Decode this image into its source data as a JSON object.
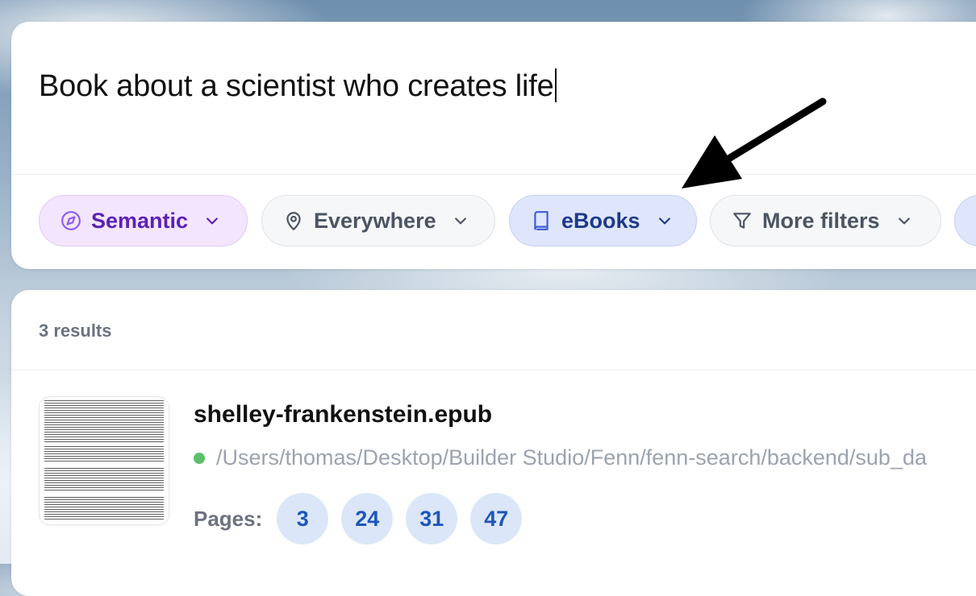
{
  "search": {
    "query": "Book about a scientist who creates life"
  },
  "filters": {
    "mode": {
      "label": "Semantic",
      "icon": "compass-icon"
    },
    "location": {
      "label": "Everywhere",
      "icon": "location-pin-icon"
    },
    "type": {
      "label": "eBooks",
      "icon": "book-icon"
    },
    "more": {
      "label": "More filters",
      "icon": "funnel-icon"
    }
  },
  "results": {
    "count_label": "3 results",
    "items": [
      {
        "file_name": "shelley-frankenstein.epub",
        "path": "/Users/thomas/Desktop/Builder Studio/Fenn/fenn-search/backend/sub_da",
        "status_color": "#5cc06a",
        "pages_label": "Pages:",
        "pages": [
          "3",
          "24",
          "31",
          "47"
        ]
      }
    ]
  },
  "colors": {
    "semantic_chip": "#f3e5fd",
    "type_chip": "#dfe6fb",
    "page_pill": "#dbe7f8"
  }
}
